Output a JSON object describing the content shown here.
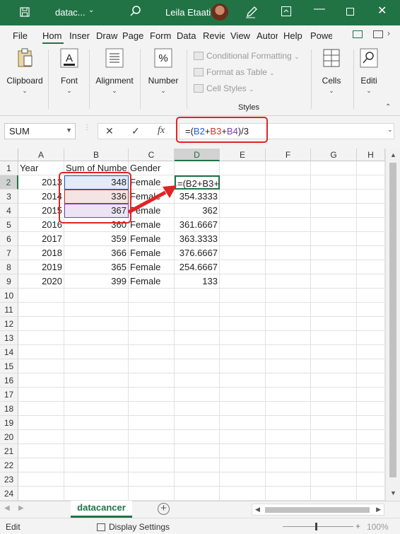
{
  "titlebar": {
    "filename": "datac...",
    "user_name": "Leila Etaati",
    "icons": [
      "save-icon",
      "search-icon",
      "pen-icon",
      "ribbon-display-options-icon",
      "minimize-icon",
      "maximize-icon",
      "close-icon"
    ]
  },
  "tabs": [
    "File",
    "Hom",
    "Inser",
    "Draw",
    "Page",
    "Form",
    "Data",
    "Revie",
    "View",
    "Autor",
    "Help",
    "Powe"
  ],
  "ribbon": {
    "clipboard": "Clipboard",
    "font": "Font",
    "alignment": "Alignment",
    "number": "Number",
    "conditional_formatting": "Conditional Formatting",
    "format_as_table": "Format as Table",
    "cell_styles": "Cell Styles",
    "styles_group": "Styles",
    "cells": "Cells",
    "editing": "Editi"
  },
  "formula_bar": {
    "name_box": "SUM",
    "fx": "fx",
    "formula_parts": [
      "=(",
      "B2",
      "+",
      "B3",
      "+",
      "B4",
      ")/3"
    ]
  },
  "grid": {
    "columns": [
      "A",
      "B",
      "C",
      "D",
      "E",
      "F",
      "G",
      "H"
    ],
    "selected_column": "D",
    "rows": [
      "1",
      "2",
      "3",
      "4",
      "5",
      "6",
      "7",
      "8",
      "9",
      "10",
      "11",
      "12",
      "13",
      "14",
      "15",
      "16",
      "17",
      "18",
      "19",
      "20",
      "21",
      "22",
      "23",
      "24"
    ],
    "selected_row": "2",
    "headers": [
      "Year",
      "Sum of Numbe",
      "Gender"
    ],
    "data": [
      [
        "2013",
        "348",
        "Female",
        "=(B2+B3+"
      ],
      [
        "2014",
        "336",
        "Female",
        "354.3333"
      ],
      [
        "2015",
        "367",
        "Female",
        "362"
      ],
      [
        "2016",
        "360",
        "Female",
        "361.6667"
      ],
      [
        "2017",
        "359",
        "Female",
        "363.3333"
      ],
      [
        "2018",
        "366",
        "Female",
        "376.6667"
      ],
      [
        "2019",
        "365",
        "Female",
        "254.6667"
      ],
      [
        "2020",
        "399",
        "Female",
        "133"
      ]
    ]
  },
  "sheets": {
    "active": "datacancer"
  },
  "status": {
    "mode": "Edit",
    "display_settings": "Display Settings",
    "zoom": "100%"
  },
  "colors": {
    "excel_green": "#217346",
    "ref_blue": "#1f5fbf",
    "ref_red": "#c0392b",
    "ref_purple": "#7b3fb0",
    "callout_red": "#e02424"
  }
}
